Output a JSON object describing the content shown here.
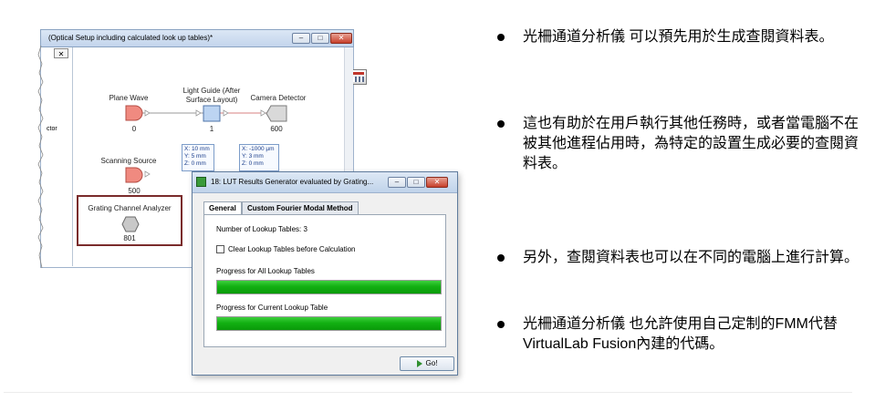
{
  "back_window": {
    "title": "(Optical Setup including calculated look up tables)*",
    "buttons": {
      "minimize": "‒",
      "maximize": "□",
      "close": "✕"
    },
    "left_pane": {
      "close_label": "✕",
      "partial_label": "ctor"
    },
    "nodes": {
      "plane_wave": {
        "label": "Plane Wave",
        "number": "0"
      },
      "light_guide": {
        "label_line1": "Light Guide (After",
        "label_line2": "Surface Layout)",
        "number": "1"
      },
      "camera_detector": {
        "label": "Camera Detector",
        "number": "600"
      },
      "scanning_source": {
        "label": "Scanning Source",
        "number": "500"
      },
      "grating_channel_analyzer": {
        "label": "Grating Channel Analyzer",
        "number": "801"
      }
    },
    "info_left": [
      "X: 10 mm",
      "Y: 5 mm",
      "Z: 0 mm"
    ],
    "info_right": [
      "X: -1000 µm",
      "Y: 3 mm",
      "Z: 0 mm"
    ]
  },
  "dialog": {
    "title": "18: LUT Results Generator evaluated by Grating...",
    "buttons": {
      "minimize": "‒",
      "maximize": "□",
      "close": "✕"
    },
    "tabs": [
      {
        "label": "General",
        "active": true
      },
      {
        "label": "Custom Fourier Modal Method",
        "active": false
      }
    ],
    "lookup_count_text": "Number of Lookup Tables: 3",
    "checkbox_label": "Clear Lookup Tables before Calculation",
    "checkbox_checked": false,
    "progress_all_label": "Progress for All Lookup Tables",
    "progress_all_value": 100,
    "progress_current_label": "Progress for Current Lookup Table",
    "progress_current_value": 100,
    "go_label": "Go!"
  },
  "bullets": [
    {
      "text": "光柵通道分析儀 可以預先用於生成查閱資料表。"
    },
    {
      "text": "這也有助於在用戶執行其他任務時，或者當電腦不在被其他進程佔用時，為特定的設置生成必要的查閱資料表。"
    },
    {
      "text": "另外，查閱資料表也可以在不同的電腦上進行計算。"
    },
    {
      "text": "光柵通道分析儀 也允許使用自己定制的FMM代替VirtualLab Fusion內建的代碼。"
    }
  ],
  "colors": {
    "progress_fill": "#12b012",
    "source_node": "#f08a80",
    "detector_node": "#d9d9d9",
    "light_guide_node": "#bcd4f2",
    "analyzer_node": "#c8c8c8",
    "highlight_border": "#7a2b2b"
  }
}
